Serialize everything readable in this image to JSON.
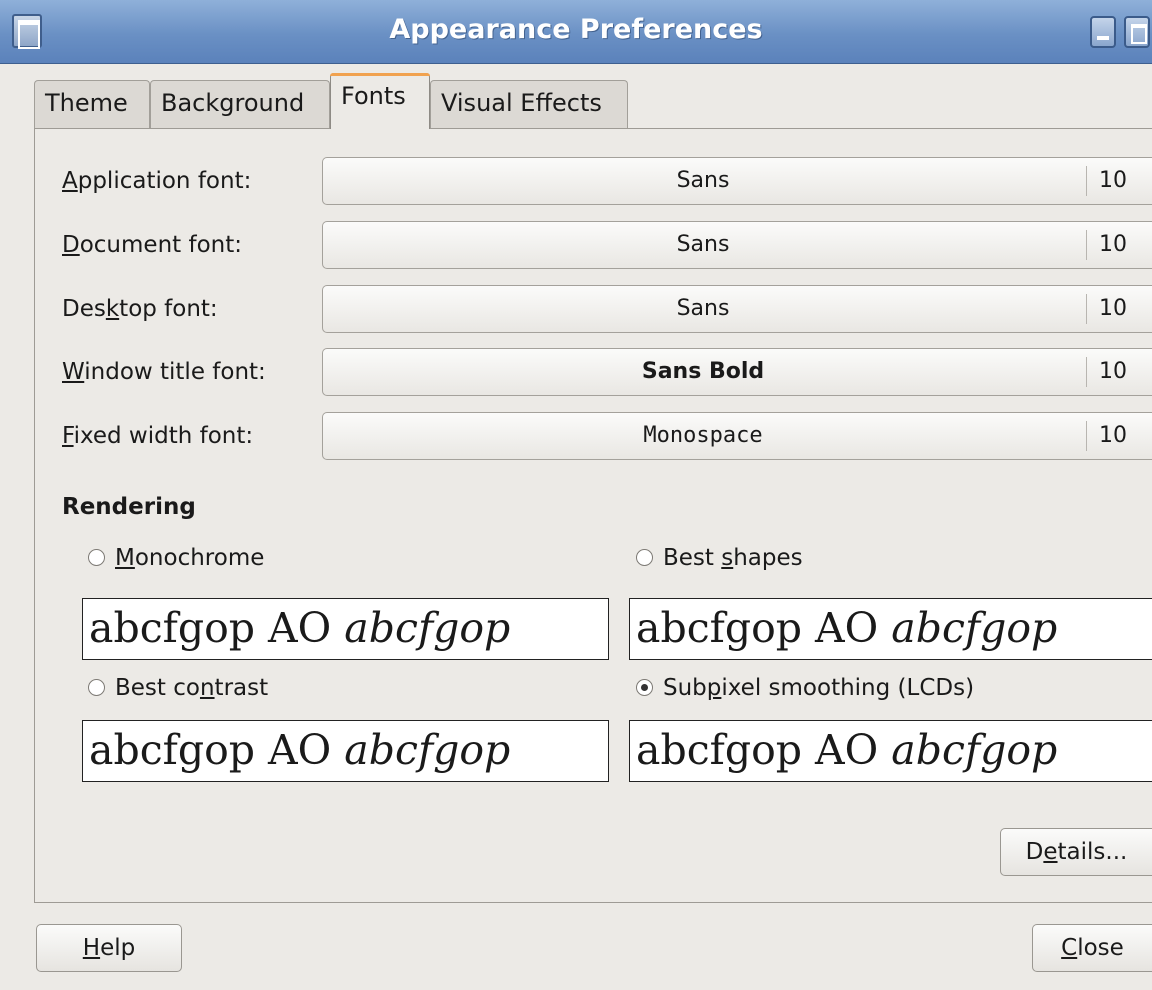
{
  "window": {
    "title": "Appearance Preferences"
  },
  "tabs": [
    {
      "label": "Theme",
      "active": false
    },
    {
      "label": "Background",
      "active": false
    },
    {
      "label": "Fonts",
      "active": true
    },
    {
      "label": "Visual Effects",
      "active": false
    }
  ],
  "fonts": {
    "application": {
      "label": "Application font:",
      "mnemonic_pre": "",
      "mnemonic": "A",
      "mnemonic_post": "pplication font:",
      "family": "Sans",
      "size": "10"
    },
    "document": {
      "label": "Document font:",
      "mnemonic_pre": "",
      "mnemonic": "D",
      "mnemonic_post": "ocument font:",
      "family": "Sans",
      "size": "10"
    },
    "desktop": {
      "label": "Desktop font:",
      "mnemonic_pre": "Des",
      "mnemonic": "k",
      "mnemonic_post": "top font:",
      "family": "Sans",
      "size": "10"
    },
    "window_title": {
      "label": "Window title font:",
      "mnemonic_pre": "",
      "mnemonic": "W",
      "mnemonic_post": "indow title font:",
      "family": "Sans Bold",
      "size": "10"
    },
    "fixed_width": {
      "label": "Fixed width font:",
      "mnemonic_pre": "",
      "mnemonic": "F",
      "mnemonic_post": "ixed width font:",
      "family": "Monospace",
      "size": "10"
    }
  },
  "rendering": {
    "title": "Rendering",
    "options": [
      {
        "label_pre": "",
        "mnemonic": "M",
        "label_post": "onochrome",
        "selected": false
      },
      {
        "label_pre": "Best ",
        "mnemonic": "s",
        "label_post": "hapes",
        "selected": false
      },
      {
        "label_pre": "Best co",
        "mnemonic": "n",
        "label_post": "trast",
        "selected": false
      },
      {
        "label_pre": "Sub",
        "mnemonic": "p",
        "label_post": "ixel smoothing (LCDs)",
        "selected": true
      }
    ],
    "sample_upright": "abcfgop AO ",
    "sample_italic": "abcfgop"
  },
  "buttons": {
    "details_pre": "D",
    "details_mnemonic": "e",
    "details_post": "tails...",
    "help_mnemonic": "H",
    "help_post": "elp",
    "close_mnemonic": "C",
    "close_post": "lose"
  }
}
